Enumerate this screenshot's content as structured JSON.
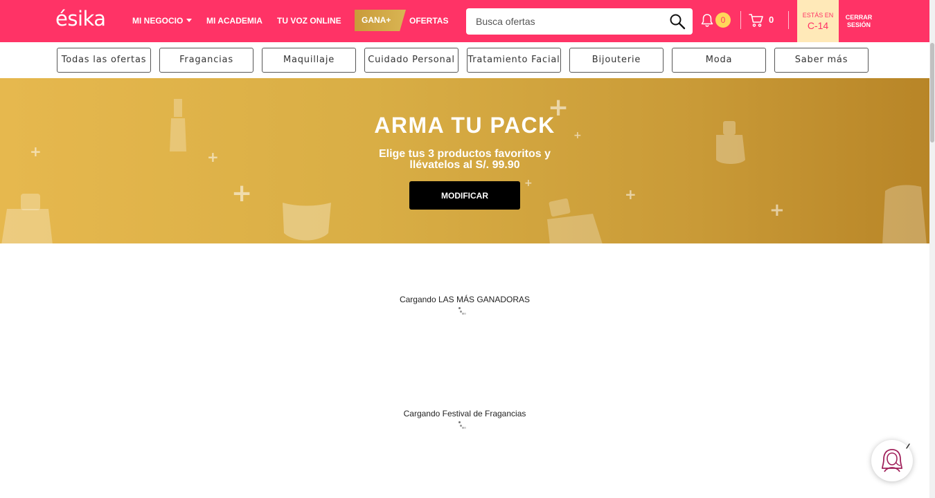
{
  "header": {
    "logo_text": "ésika",
    "nav": [
      {
        "label": "MI NEGOCIO"
      },
      {
        "label": "MI ACADEMIA"
      },
      {
        "label": "TU VOZ ONLINE"
      }
    ],
    "gana_label": "GANA+",
    "ofertas_label": "OFERTAS",
    "search_placeholder": "Busca ofertas",
    "notifications_count": "0",
    "cart_count": "0",
    "campaign_caption": "ESTÁS EN",
    "campaign_code": "C-14",
    "logout_line1": "CERRAR",
    "logout_line2": "SESIÓN",
    "colors": {
      "brand": "#ff3366",
      "badge": "#ffd65a",
      "campaign_bg": "#ffe9b8"
    }
  },
  "categories": [
    {
      "label": "Todas las ofertas"
    },
    {
      "label": "Fragancias"
    },
    {
      "label": "Maquillaje"
    },
    {
      "label": "Cuidado Personal"
    },
    {
      "label": "Tratamiento Facial"
    },
    {
      "label": "Bijouterie"
    },
    {
      "label": "Moda"
    },
    {
      "label": "Saber más"
    }
  ],
  "banner": {
    "title": "ARMA TU PACK",
    "subtitle": "Elige tus 3 productos favoritos y llévatelos al S/. 99.90",
    "button_label": "MODIFICAR"
  },
  "sections": [
    {
      "loading_text": "Cargando LAS MÁS GANADORAS"
    },
    {
      "loading_text": "Cargando Festival de Fragancias"
    }
  ],
  "icons": {
    "search": "search-icon",
    "bell": "bell-icon",
    "cart": "cart-icon",
    "chat": "chat-assistant-icon"
  }
}
